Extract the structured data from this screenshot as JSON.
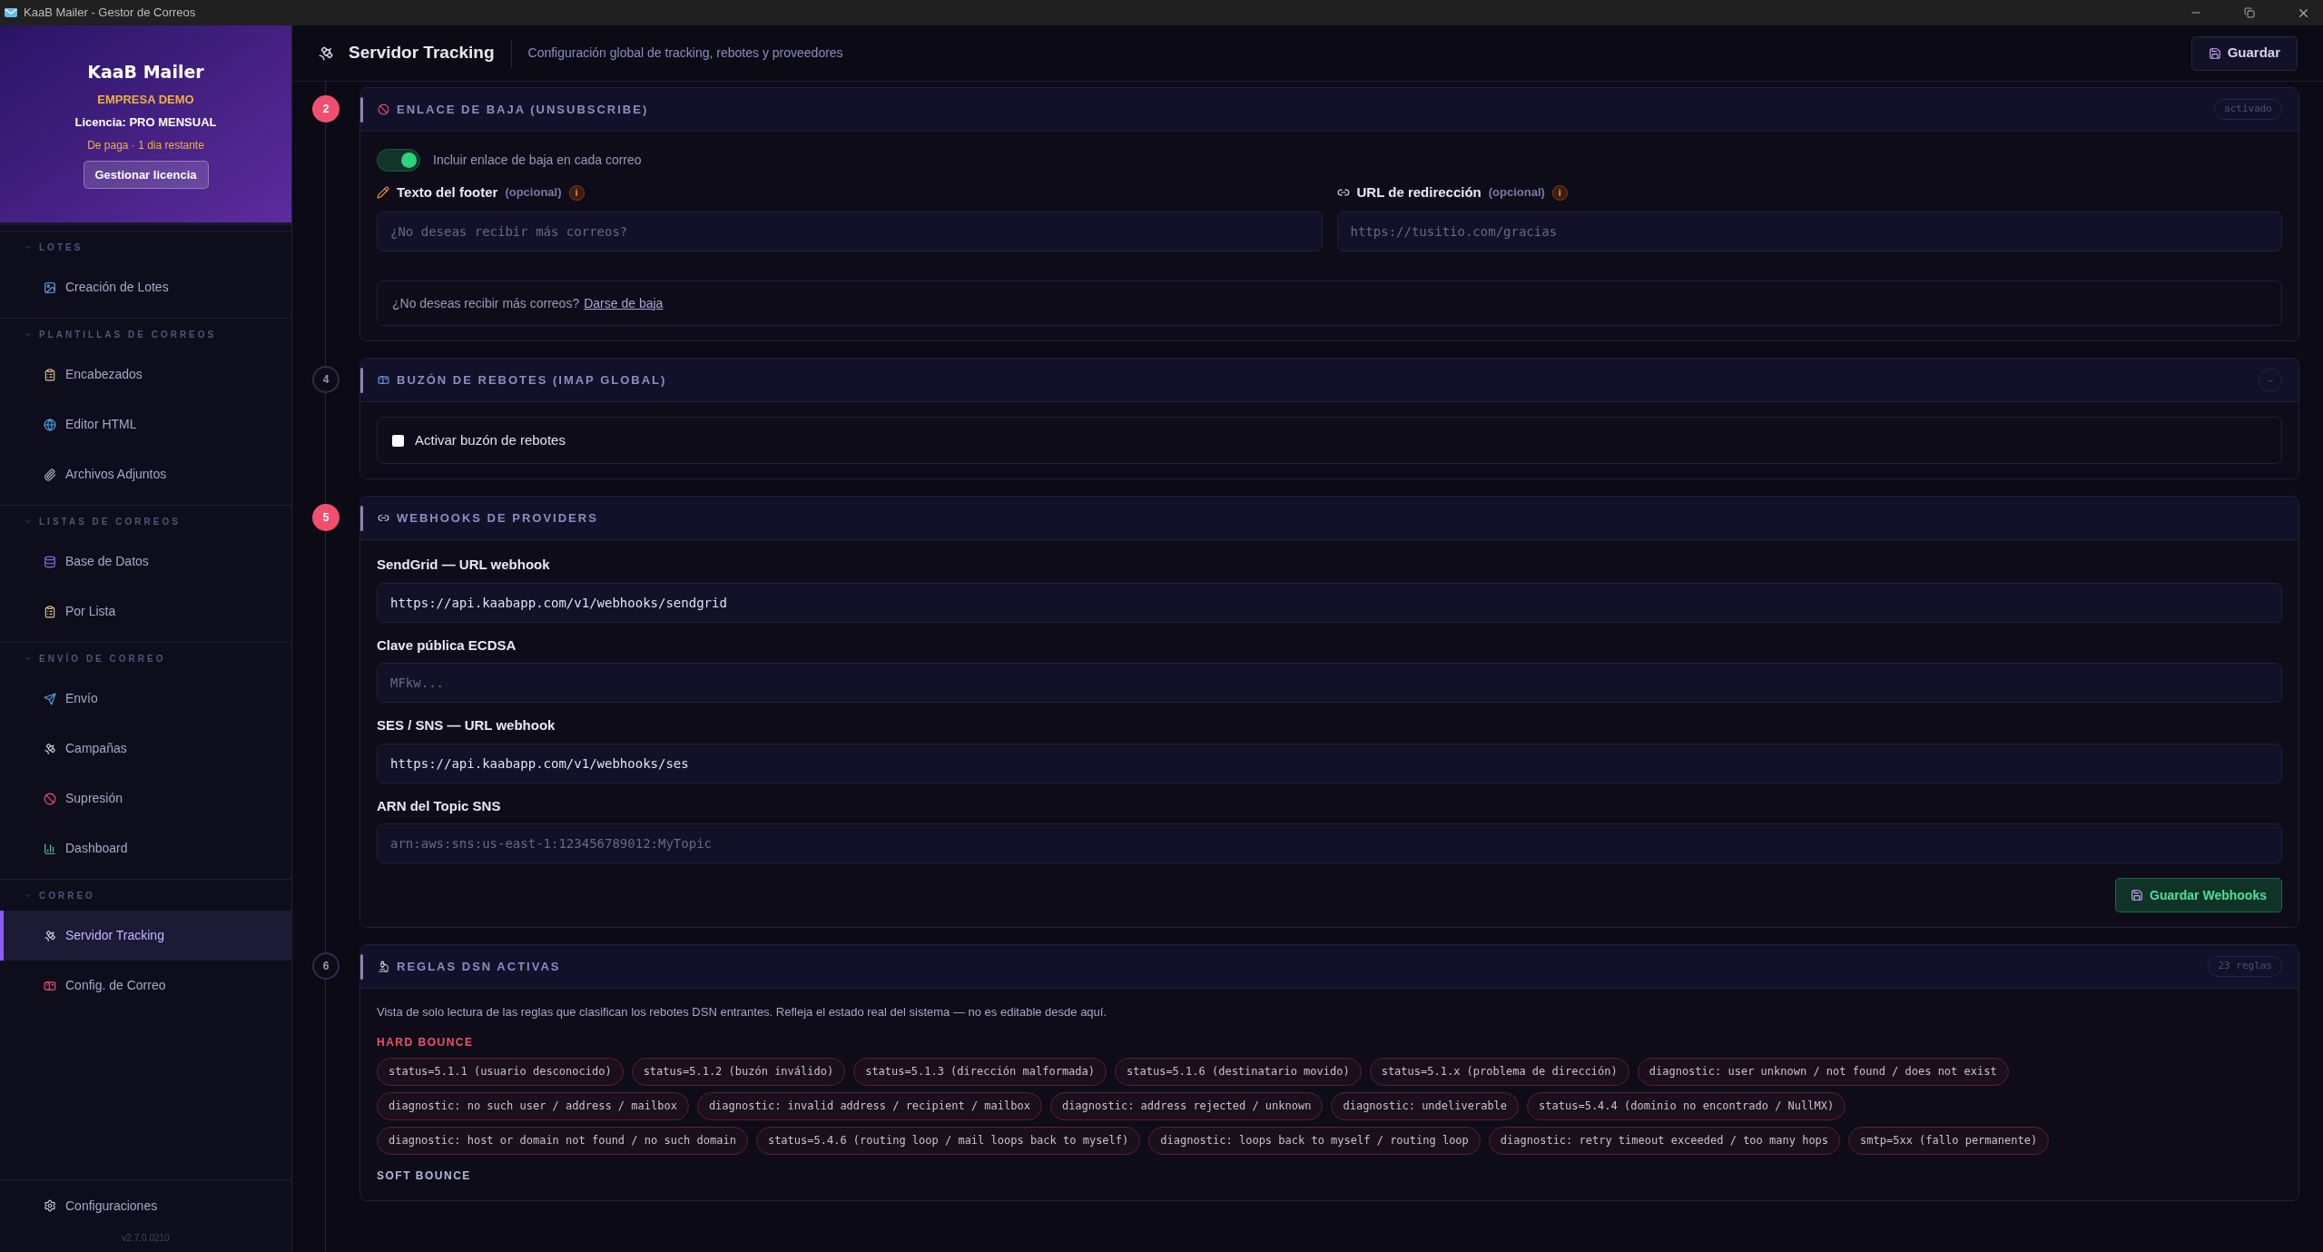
{
  "window": {
    "title": "KaaB Mailer - Gestor de Correos"
  },
  "sidebar": {
    "brand": "KaaB Mailer",
    "company": "EMPRESA DEMO",
    "license": "Licencia: PRO MENSUAL",
    "license_status": "De paga · 1 dia restante",
    "license_button": "Gestionar licencia",
    "groups": [
      {
        "label": "LOTES",
        "expanded": true,
        "items": [
          {
            "label": "Creación de Lotes",
            "kind": "image",
            "selected": false
          }
        ]
      },
      {
        "label": "PLANTILLAS DE CORREOS",
        "expanded": true,
        "items": [
          {
            "label": "Encabezados",
            "kind": "clipboard",
            "selected": false
          },
          {
            "label": "Editor HTML",
            "kind": "globe",
            "selected": false
          },
          {
            "label": "Archivos Adjuntos",
            "kind": "paperclip",
            "selected": false
          }
        ]
      },
      {
        "label": "LISTAS DE CORREOS",
        "expanded": true,
        "items": [
          {
            "label": "Base de Datos",
            "kind": "database",
            "selected": false
          },
          {
            "label": "Por Lista",
            "kind": "clipboard",
            "selected": false
          }
        ]
      },
      {
        "label": "ENVÍO DE CORREO",
        "expanded": true,
        "items": [
          {
            "label": "Envío",
            "kind": "outbox",
            "selected": false
          },
          {
            "label": "Campañas",
            "kind": "satellite",
            "selected": false
          },
          {
            "label": "Supresión",
            "kind": "ban",
            "selected": false
          },
          {
            "label": "Dashboard",
            "kind": "chart",
            "selected": false
          }
        ]
      },
      {
        "label": "CORREO",
        "expanded": true,
        "items": [
          {
            "label": "Servidor Tracking",
            "kind": "satellite",
            "selected": true
          },
          {
            "label": "Config. de Correo",
            "kind": "mailbox",
            "selected": false
          }
        ]
      }
    ],
    "footer": "Configuraciones",
    "version": "v2.7.0.0210"
  },
  "header": {
    "title": "Servidor Tracking",
    "subtitle": "Configuración global de tracking, rebotes y proveedores",
    "save_button": "Guardar"
  },
  "sections": [
    {
      "kind": "unsubscribe",
      "step": "2",
      "highlighted": true,
      "title": "ENLACE DE BAJA (UNSUBSCRIBE)",
      "badge": "activado",
      "toggle": {
        "label": "Incluir enlace de baja en cada correo",
        "on": true
      },
      "fields": [
        {
          "kind": "pencil",
          "label": "Texto del footer",
          "hint": "(opcional)",
          "info": "i",
          "placeholder": "¿No deseas recibir más correos?"
        },
        {
          "kind": "link",
          "label": "URL de redirección",
          "hint": "(opcional)",
          "info": "i",
          "placeholder": "https://tusitio.com/gracias"
        }
      ],
      "preview": {
        "text": "¿No deseas recibir más correos?",
        "link": "Darse de baja"
      }
    },
    {
      "kind": "bounce_mailbox",
      "step": "4",
      "highlighted": false,
      "title": "BUZÓN DE REBOTES (IMAP GLOBAL)",
      "collapse": "–",
      "checkbox": {
        "label": "Activar buzón de rebotes",
        "checked": false
      }
    },
    {
      "kind": "webhooks",
      "step": "5",
      "highlighted": true,
      "title": "WEBHOOKS DE PROVIDERS",
      "fields": [
        {
          "label": "SendGrid — URL webhook",
          "value": "https://api.kaabapp.com/v1/webhooks/sendgrid"
        },
        {
          "label": "Clave pública ECDSA",
          "placeholder": "MFkw..."
        },
        {
          "label": "SES / SNS — URL webhook",
          "value": "https://api.kaabapp.com/v1/webhooks/ses"
        },
        {
          "label": "ARN del Topic SNS",
          "placeholder": "arn:aws:sns:us-east-1:123456789012:MyTopic"
        }
      ],
      "button": "Guardar Webhooks"
    },
    {
      "kind": "dsn_rules",
      "step": "6",
      "highlighted": false,
      "title": "REGLAS DSN ACTIVAS",
      "badge": "23 reglas",
      "description": "Vista de solo lectura de las reglas que clasifican los rebotes DSN entrantes. Refleja el estado real del sistema — no es editable desde aquí.",
      "groups": [
        {
          "label": "HARD BOUNCE",
          "color": "#f0506e",
          "tags": [
            "status=5.1.1 (usuario desconocido)",
            "status=5.1.2 (buzón inválido)",
            "status=5.1.3 (dirección malformada)",
            "status=5.1.6 (destinatario movido)",
            "status=5.1.x (problema de dirección)",
            "diagnostic: user unknown / not found / does not exist",
            "diagnostic: no such user / address / mailbox",
            "diagnostic: invalid address / recipient / mailbox",
            "diagnostic: address rejected / unknown",
            "diagnostic: undeliverable",
            "status=5.4.4 (dominio no encontrado / NullMX)",
            "diagnostic: host or domain not found / no such domain",
            "status=5.4.6 (routing loop / mail loops back to myself)",
            "diagnostic: loops back to myself / routing loop",
            "diagnostic: retry timeout exceeded / too many hops",
            "smtp=5xx (fallo permanente)"
          ]
        },
        {
          "label": "SOFT BOUNCE",
          "color": "#b8b6d6"
        }
      ]
    }
  ]
}
